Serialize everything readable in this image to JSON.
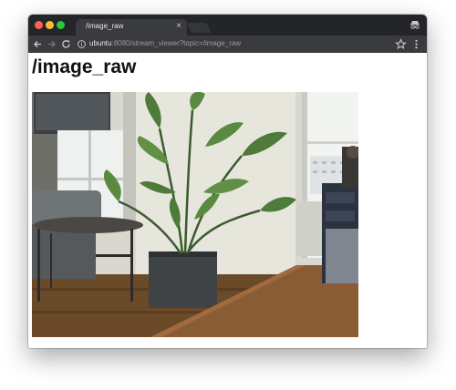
{
  "browser": {
    "tab": {
      "title": "/image_raw",
      "close_glyph": "×"
    },
    "toolbar": {
      "back_icon": "back-arrow-icon",
      "forward_icon": "forward-arrow-icon",
      "reload_icon": "reload-icon",
      "url_host": "ubuntu",
      "url_rest": ":8080/stream_viewer?topic=/image_raw",
      "star_icon": "bookmark-star-icon",
      "menu_icon": "kebab-menu-icon"
    },
    "colors": {
      "tab_strip": "#242529",
      "toolbar": "#3a3b3f",
      "close": "#ff5f57",
      "minimize": "#febc2e",
      "maximize": "#28c840"
    }
  },
  "page": {
    "heading": "/image_raw",
    "stream_image": {
      "scene": "camera-frame-office-plant"
    }
  }
}
